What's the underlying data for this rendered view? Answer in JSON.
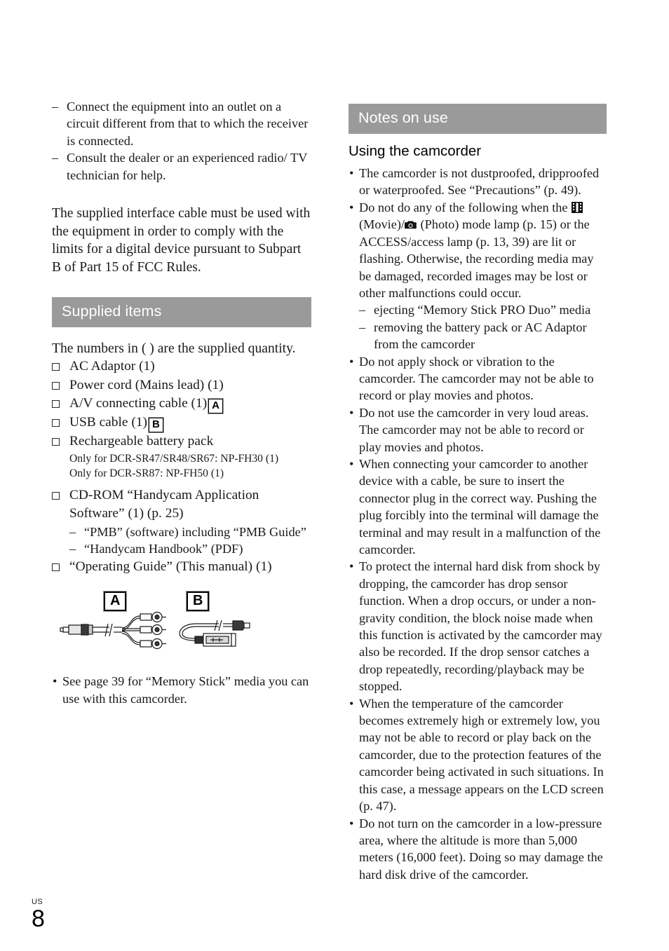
{
  "page": {
    "folio_label": "US",
    "folio_number": "8",
    "accent_gray": "#9a9a9a"
  },
  "left_column": {
    "fcc_dash_items": [
      "Connect the equipment into an outlet on a circuit different from that to which the receiver is connected.",
      "Consult the dealer or an experienced radio/ TV technician for help."
    ],
    "fcc_paragraph": "The supplied interface cable must be used with the equipment in order to comply with the limits for a digital device pursuant to Subpart B of Part 15 of FCC Rules.",
    "supplied_items": {
      "header": "Supplied items",
      "intro": "The numbers in ( ) are the supplied quantity.",
      "items": [
        {
          "text": "AC Adaptor (1)",
          "badge": ""
        },
        {
          "text": "Power cord (Mains lead) (1)",
          "badge": ""
        },
        {
          "text": "A/V connecting cable (1)",
          "badge": "A"
        },
        {
          "text": "USB cable (1)",
          "badge": "B"
        },
        {
          "text": "Rechargeable battery pack",
          "badge": ""
        }
      ],
      "battery_notes": [
        "Only for DCR-SR47/SR48/SR67: NP-FH30 (1)",
        "Only for DCR-SR87: NP-FH50 (1)"
      ],
      "cdrom_item": "CD-ROM “Handycam Application Software” (1) (p. 25)",
      "cdrom_sub_items": [
        "“PMB” (software) including “PMB Guide”",
        "“Handycam Handbook” (PDF)"
      ],
      "guide_item": "“Operating Guide” (This manual) (1)"
    },
    "cable_figure": {
      "label_a": "A",
      "label_b": "B",
      "caption_a": "av-connecting-cable",
      "caption_b": "usb-cable"
    },
    "memory_stick_note": "See page 39 for “Memory Stick” media you can use with this camcorder."
  },
  "right_column": {
    "header": "Notes on use",
    "subheading": "Using the camcorder",
    "bullets": [
      {
        "id": "dustproof",
        "text": "The camcorder is not dustproofed, dripproofed or waterproofed. See “Precautions” (p. 49).",
        "sub": []
      },
      {
        "id": "mode-lamp",
        "text_before_movie": "Do not do any of the following when the ",
        "text_after_movie": " (Movie)/",
        "text_after_photo": " (Photo) mode lamp (p. 15) or the ACCESS/access lamp (p. 13, 39) are lit or flashing. Otherwise, the recording media may be damaged, recorded images may be lost or other malfunctions could occur.",
        "sub": [
          "ejecting “Memory Stick PRO Duo” media",
          "removing the battery pack or AC Adaptor from the camcorder"
        ]
      },
      {
        "id": "shock-vibration",
        "text": "Do not apply shock or vibration to the camcorder. The camcorder may not be able to record or play movies and photos.",
        "sub": []
      },
      {
        "id": "loud-areas",
        "text": "Do not use the camcorder in very loud areas. The camcorder may not be able to record or play movies and photos.",
        "sub": []
      },
      {
        "id": "connector-plug",
        "text": "When connecting your camcorder to another device with a cable, be sure to insert the connector plug in the correct way. Pushing the plug forcibly into the terminal will damage the terminal and may result in a malfunction of the camcorder.",
        "sub": []
      },
      {
        "id": "drop-sensor",
        "text": "To protect the internal hard disk from shock by dropping, the camcorder has drop sensor function. When a drop occurs, or under a non-gravity condition, the block noise made when this function is activated by the camcorder may also be recorded. If the drop sensor catches a drop repeatedly, recording/playback may be stopped.",
        "sub": []
      },
      {
        "id": "temperature",
        "text": "When the temperature of the camcorder becomes extremely high or extremely low, you may not be able to record or play back on the camcorder, due to the protection features of the camcorder being activated in such situations. In this case, a message appears on the LCD screen (p. 47).",
        "sub": []
      },
      {
        "id": "low-pressure",
        "text": "Do not turn on the camcorder in a low-pressure area, where the altitude is more than 5,000 meters (16,000 feet). Doing so may damage the hard disk drive of the camcorder.",
        "sub": []
      }
    ],
    "icons": {
      "movie": "movie-film-icon",
      "photo": "photo-camera-icon"
    }
  },
  "symbols": {
    "bullet": "•",
    "dash": "–"
  }
}
